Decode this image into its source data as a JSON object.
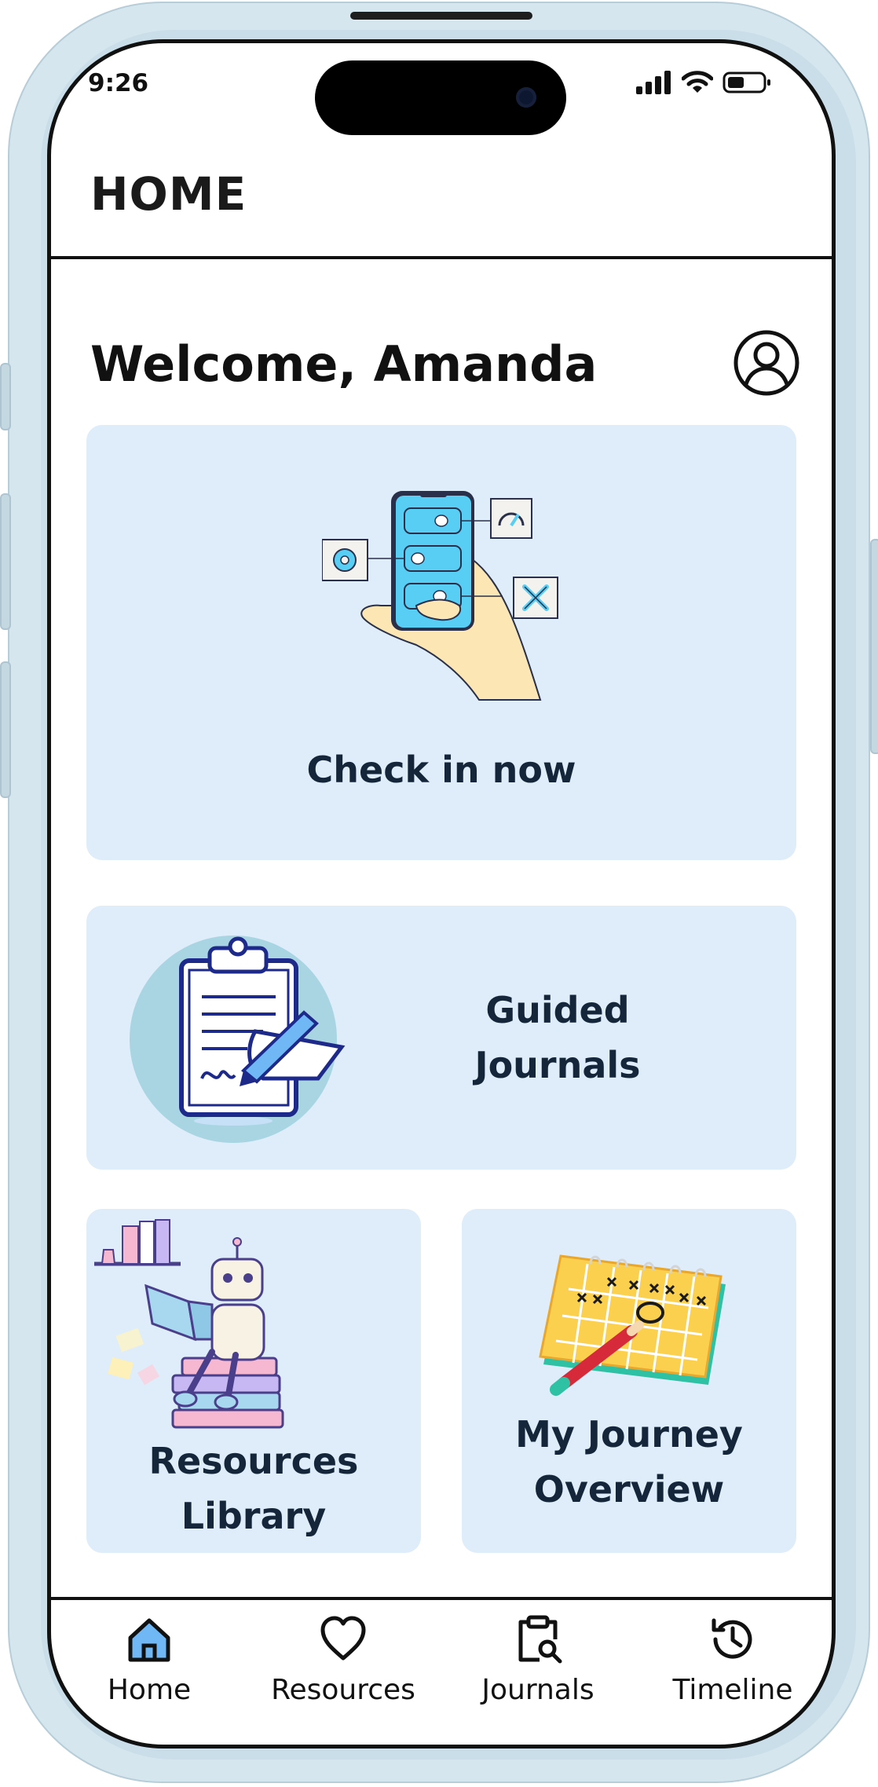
{
  "status_bar": {
    "time": "9:26"
  },
  "header": {
    "title": "HOME"
  },
  "welcome": {
    "text": "Welcome, Amanda"
  },
  "cards": {
    "check_in": {
      "label": "Check in now"
    },
    "guided_journals": {
      "line1": "Guided",
      "line2": "Journals"
    },
    "resources_library": {
      "line1": "Resources",
      "line2": "Library"
    },
    "journey_overview": {
      "line1": "My Journey",
      "line2": "Overview"
    }
  },
  "nav": {
    "items": [
      {
        "label": "Home",
        "icon": "home-icon",
        "active": true
      },
      {
        "label": "Resources",
        "icon": "heart-icon",
        "active": false
      },
      {
        "label": "Journals",
        "icon": "clipboard-search-icon",
        "active": false
      },
      {
        "label": "Timeline",
        "icon": "history-icon",
        "active": false
      }
    ]
  },
  "colors": {
    "card_bg": "#deedf9",
    "accent_blue": "#6fb7f5",
    "text_dark": "#16263a"
  }
}
